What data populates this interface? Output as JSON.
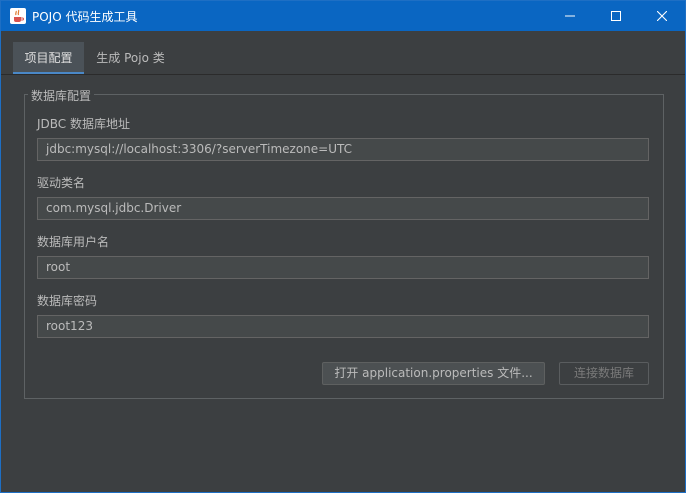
{
  "window": {
    "title": "POJO 代码生成工具"
  },
  "tabs": [
    {
      "label": "项目配置"
    },
    {
      "label": "生成 Pojo 类"
    }
  ],
  "group": {
    "title": "数据库配置",
    "fields": [
      {
        "label": "JDBC 数据库地址",
        "value": "jdbc:mysql://localhost:3306/?serverTimezone=UTC"
      },
      {
        "label": "驱动类名",
        "value": "com.mysql.jdbc.Driver"
      },
      {
        "label": "数据库用户名",
        "value": "root"
      },
      {
        "label": "数据库密码",
        "value": "root123"
      }
    ],
    "buttons": {
      "open": "打开 application.properties 文件...",
      "connect": "连接数据库"
    }
  }
}
